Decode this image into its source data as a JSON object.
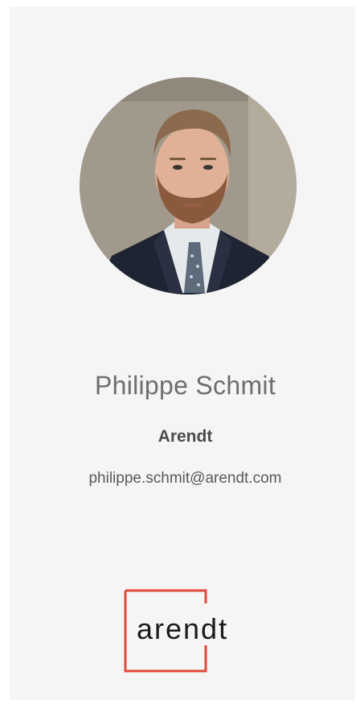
{
  "profile": {
    "name": "Philippe Schmit",
    "company": "Arendt",
    "email": "philippe.schmit@arendt.com"
  },
  "logo": {
    "text": "arendt",
    "accent_color": "#e04a3a"
  },
  "colors": {
    "card_background": "#f5f5f5",
    "name_text": "#6e6e72",
    "company_text": "#4d4d4d",
    "email_text": "#5a5a5a"
  }
}
